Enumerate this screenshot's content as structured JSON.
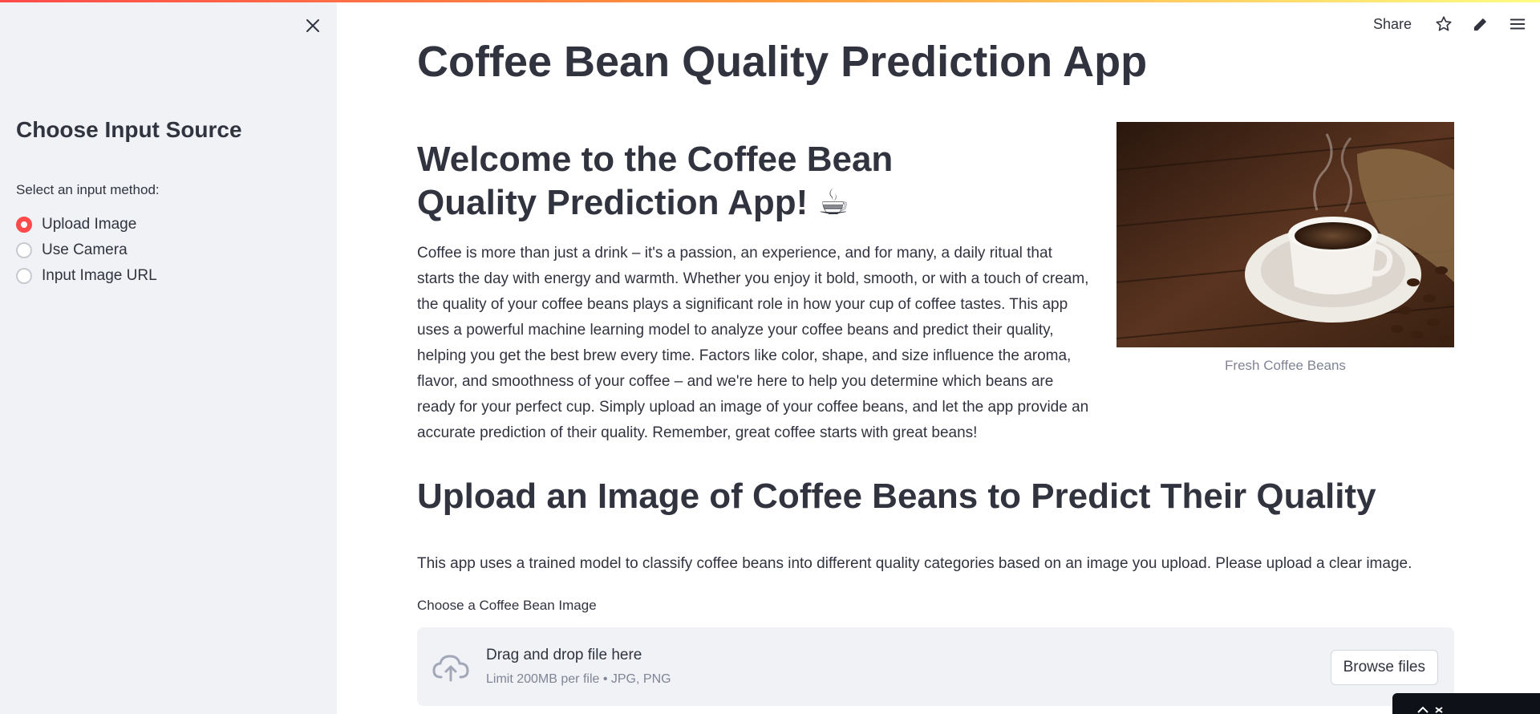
{
  "sidebar": {
    "title": "Choose Input Source",
    "radio_label": "Select an input method:",
    "options": [
      {
        "label": "Upload Image",
        "selected": true
      },
      {
        "label": "Use Camera",
        "selected": false
      },
      {
        "label": "Input Image URL",
        "selected": false
      }
    ],
    "close_icon": "close-icon"
  },
  "toolbar": {
    "share_label": "Share",
    "icons": [
      "star-icon",
      "pencil-icon",
      "hamburger-menu-icon"
    ]
  },
  "main": {
    "title": "Coffee Bean Quality Prediction App",
    "welcome_heading": "Welcome to the Coffee Bean Quality Prediction App! ☕",
    "intro_text": "Coffee is more than just a drink – it's a passion, an experience, and for many, a daily ritual that starts the day with energy and warmth. Whether you enjoy it bold, smooth, or with a touch of cream, the quality of your coffee beans plays a significant role in how your cup of coffee tastes. This app uses a powerful machine learning model to analyze your coffee beans and predict their quality, helping you get the best brew every time. Factors like color, shape, and size influence the aroma, flavor, and smoothness of your coffee – and we're here to help you determine which beans are ready for your perfect cup. Simply upload an image of your coffee beans, and let the app provide an accurate prediction of their quality. Remember, great coffee starts with great beans!",
    "image_caption": "Fresh Coffee Beans",
    "upload_heading": "Upload an Image of Coffee Beans to Predict Their Quality",
    "upload_description": "This app uses a trained model to classify coffee beans into different quality categories based on an image you upload. Please upload a clear image.",
    "uploader": {
      "label": "Choose a Coffee Bean Image",
      "drop_title": "Drag and drop file here",
      "limit_text": "Limit 200MB per file • JPG, PNG",
      "browse_label": "Browse files"
    }
  },
  "colors": {
    "accent": "#ff4b4b",
    "sidebar_bg": "#f0f2f6",
    "text": "#31333f",
    "muted": "#808495"
  }
}
